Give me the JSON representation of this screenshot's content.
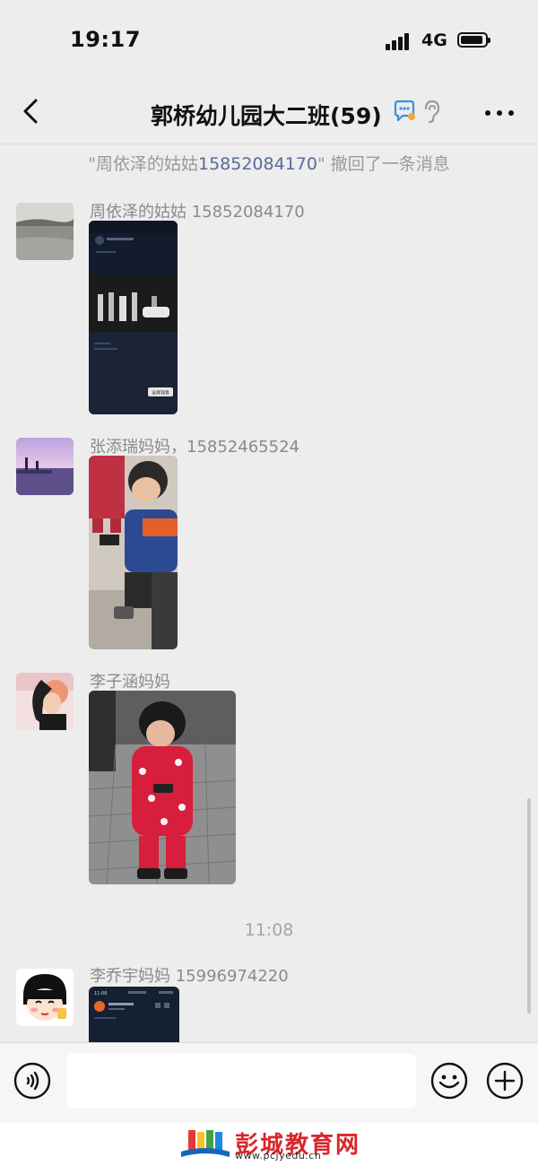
{
  "status_bar": {
    "time": "19:17",
    "network": "4G"
  },
  "header": {
    "title": "郭桥幼儿园大二班(59)",
    "back_icon": "chevron-left-icon",
    "more_icon": "more-dots-icon"
  },
  "recall_notice": {
    "quote_open": "\"",
    "name": "周依泽的姑姑",
    "phone": "15852084170",
    "quote_close": "\"",
    "suffix": " 撤回了一条消息"
  },
  "messages": [
    {
      "sender": "周依泽的姑姑 15852084170",
      "content": "image"
    },
    {
      "sender": "张添瑞妈妈，15852465524",
      "content": "image"
    },
    {
      "sender": "李子涵妈妈",
      "content": "image"
    },
    {
      "sender": "李乔宇妈妈 15996974220",
      "content": "image"
    }
  ],
  "timestamp": "11:08",
  "image_1": {
    "label": "全屏观看"
  },
  "image_4": {
    "time": "11:08"
  },
  "input_bar": {
    "placeholder": ""
  },
  "watermark": {
    "name": "彭城教育网",
    "url": "www.pcjyedu.cn"
  },
  "colors": {
    "background": "#ededed",
    "link": "#576b95",
    "watermark_red": "#d8262b"
  }
}
